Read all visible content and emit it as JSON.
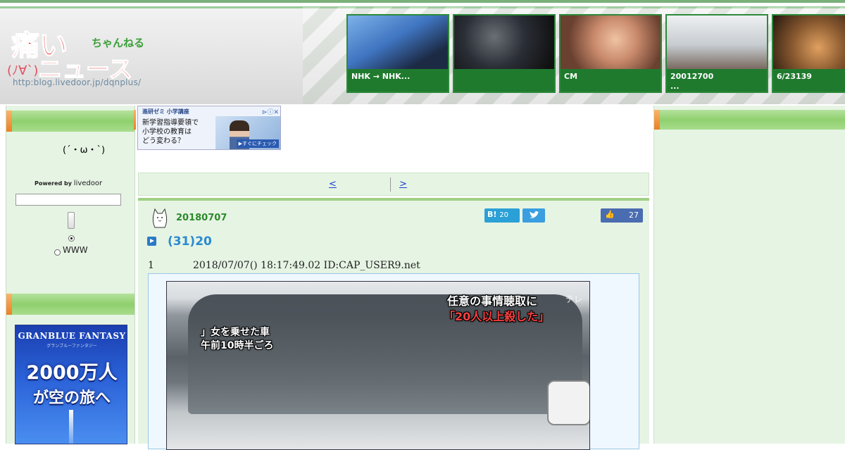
{
  "header": {
    "logo_main": "痛い",
    "logo_sub": "ニュース",
    "logo_ch": "ちゃんねる",
    "logo_face": "(ﾉ∀`)",
    "logo_url": "http:blog.livedoor.jp/dqnplus/"
  },
  "thumbs": [
    {
      "caption": "NHK → NHK...",
      "color": "#3f74c0"
    },
    {
      "caption": "",
      "color": "#2a2e36"
    },
    {
      "caption": "CM",
      "color": "#b07860"
    },
    {
      "caption": "20012700\n...",
      "color": "#c6ccd0"
    },
    {
      "caption": "6/23139",
      "color": "#8a5a30"
    }
  ],
  "sidebar": {
    "face": "(´・ω・`)",
    "powered_by": "Powered by",
    "livedoor": "livedoor",
    "search_value": "",
    "radio_www": "WWW",
    "ad": {
      "logo": "GRANBLUE FANTASY",
      "sub": "グランブルーファンタジー",
      "line1": "2000万人",
      "line2": "が空の旅へ"
    }
  },
  "top_ad": {
    "brand": "進研ゼミ 小学講座",
    "text": "新学習指導要領で\n小学校の教育は\nどう変わる？",
    "cta": "▶すぐにチェック"
  },
  "nav": {
    "prev": "<",
    "next": ">"
  },
  "article": {
    "date": "20180707",
    "hatena_label": "B!",
    "hatena_count": "20",
    "fb_count": "27",
    "title": "(31)20",
    "res_number": "1",
    "res_meta": "2018/07/07() 18:17:49.02 ID:CAP_USER9.net",
    "image": {
      "telop1": "任意の事情聴取に",
      "telop2": "「20人以上殺した」",
      "telop3a": "」女を乗せた車",
      "telop3b": "午前10時半ごろ",
      "channel": "テレ"
    }
  }
}
